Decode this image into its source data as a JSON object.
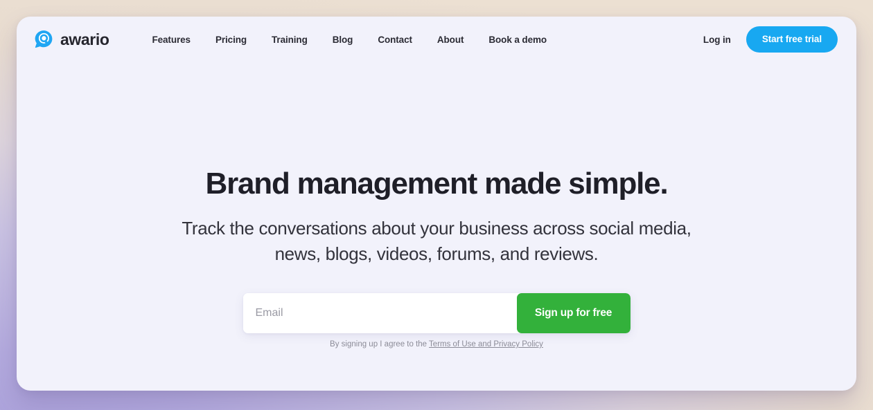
{
  "brand": {
    "name": "awario",
    "logo_icon": "awario-speech-bubble-search-icon",
    "logo_color": "#20a6f3"
  },
  "header": {
    "nav": [
      {
        "label": "Features"
      },
      {
        "label": "Pricing"
      },
      {
        "label": "Training"
      },
      {
        "label": "Blog"
      },
      {
        "label": "Contact"
      },
      {
        "label": "About"
      },
      {
        "label": "Book a demo"
      }
    ],
    "login_label": "Log in",
    "trial_label": "Start free trial",
    "trial_color": "#18a8f1"
  },
  "hero": {
    "title": "Brand management made simple.",
    "subtitle_line1": "Track the conversations about your business across social media,",
    "subtitle_line2": "news, blogs, videos, forums, and reviews.",
    "email_placeholder": "Email",
    "email_value": "",
    "signup_label": "Sign up for free",
    "signup_color": "#33b13b",
    "legal_prefix": "By signing up I agree to the ",
    "legal_link": "Terms of Use and Privacy Policy"
  },
  "theme": {
    "page_background": "#f2f2fb",
    "canvas_gradient_from": "#a79dd9",
    "canvas_gradient_to": "#ece0d2",
    "text_color": "#1f1f28"
  }
}
